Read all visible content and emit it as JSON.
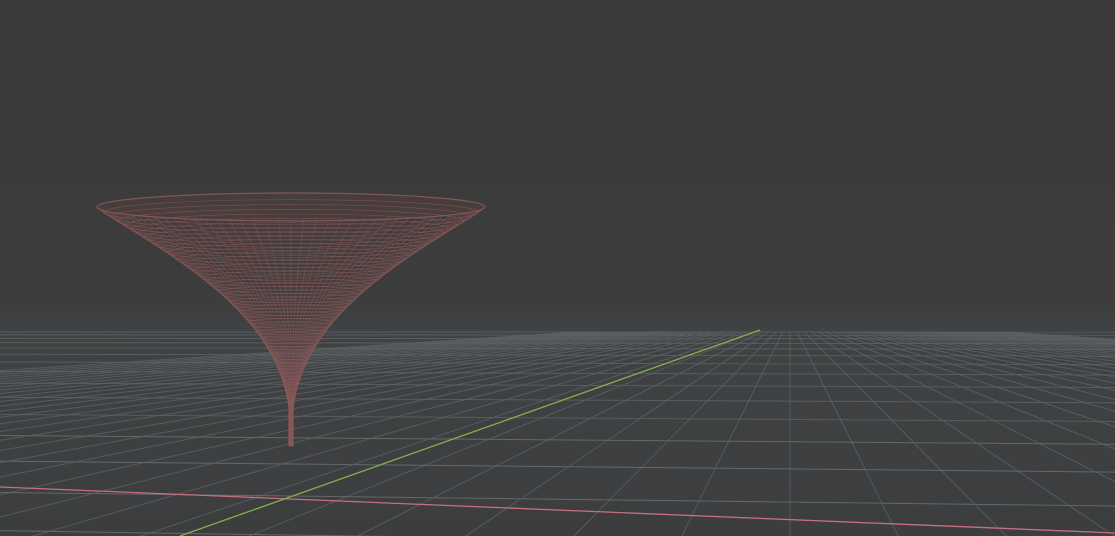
{
  "viewport": {
    "background_color": "#3b3b3b",
    "horizon_haze_color": "#3f4142"
  },
  "grid": {
    "visible": true,
    "line_color": "#5d6266",
    "line_color_near": "#6a7075"
  },
  "axes": {
    "x_axis_color": "#c86f7f",
    "y_axis_color": "#86b04d"
  },
  "object": {
    "type": "wireframe-funnel-surface",
    "wire_color": "#8a5a5a",
    "fill_color": "#4a3e3e"
  }
}
